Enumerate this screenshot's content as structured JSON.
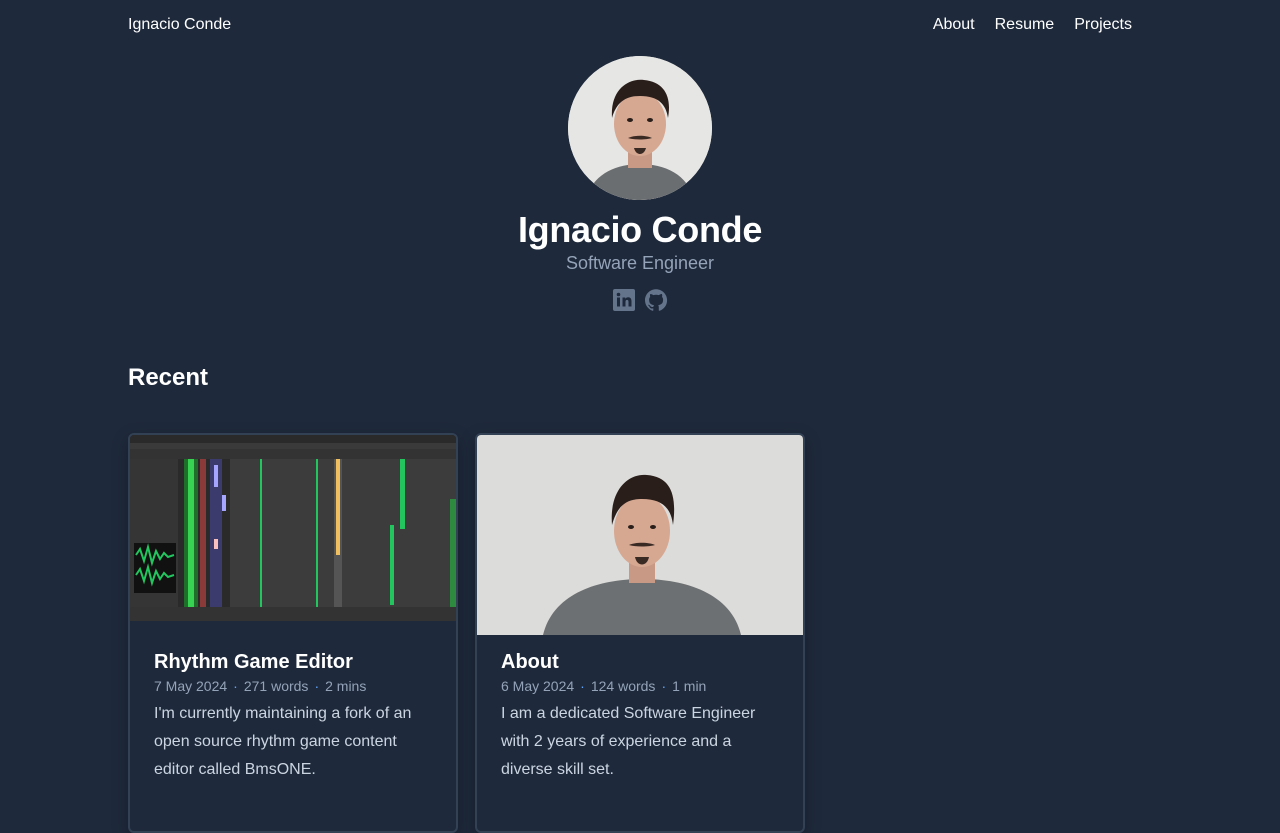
{
  "site": {
    "title": "Ignacio Conde"
  },
  "nav": {
    "items": [
      {
        "label": "About"
      },
      {
        "label": "Resume"
      },
      {
        "label": "Projects"
      }
    ]
  },
  "author": {
    "name": "Ignacio Conde",
    "headline": "Software Engineer",
    "socials": [
      {
        "icon": "linkedin-icon"
      },
      {
        "icon": "github-icon"
      }
    ]
  },
  "recent": {
    "heading": "Recent",
    "cards": [
      {
        "title": "Rhythm Game Editor",
        "date": "7 May 2024",
        "words": "271 words",
        "reading_time": "2 mins",
        "summary": "I'm currently maintaining a fork of an open source rhythm game content editor called BmsONE."
      },
      {
        "title": "About",
        "date": "6 May 2024",
        "words": "124 words",
        "reading_time": "1 min",
        "summary": "I am a dedicated Software Engineer with 2 years of experience and a diverse skill set."
      }
    ]
  },
  "colors": {
    "background": "#1e293b",
    "muted_text": "#94a3b8",
    "accent": "#60a5fa",
    "icon": "#64748b"
  }
}
